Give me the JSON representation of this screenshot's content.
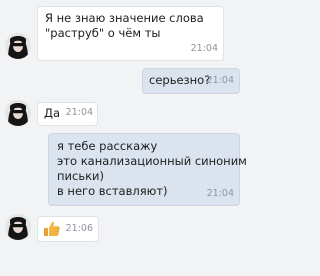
{
  "messages": [
    {
      "direction": "incoming",
      "lines": [
        "Я не знаю значение слова",
        "\"раструб\" о чём ты"
      ],
      "time": "21:04"
    },
    {
      "direction": "outgoing",
      "lines": [
        "серьезно?"
      ],
      "time": "21:04"
    },
    {
      "direction": "incoming",
      "lines": [
        "Да"
      ],
      "time": "21:04"
    },
    {
      "direction": "outgoing",
      "lines": [
        "я тебе расскажу",
        "это канализационный синоним",
        "письки)",
        "в него вставляют)"
      ],
      "time": "21:04"
    },
    {
      "direction": "incoming",
      "sticker": "thumbs-up-icon",
      "time": "21:06"
    }
  ],
  "colors": {
    "background": "#f1f3f5",
    "incoming_bubble": "#ffffff",
    "outgoing_bubble": "#dbe3ee",
    "time_text": "#8f959d",
    "thumb": "#f4b63f"
  }
}
